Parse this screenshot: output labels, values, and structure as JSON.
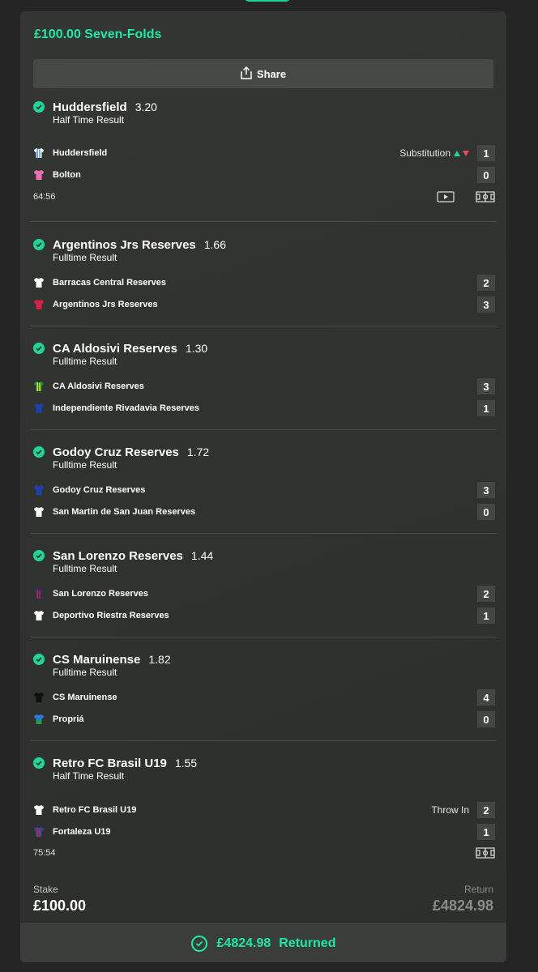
{
  "bet": {
    "title": "£100.00 Seven-Folds",
    "share_label": "Share"
  },
  "selections": [
    {
      "team": "Huddersfield",
      "odds": "3.20",
      "market": "Half Time Result",
      "home": {
        "name": "Huddersfield",
        "score": "1",
        "event": "Substitution"
      },
      "away": {
        "name": "Bolton",
        "score": "0"
      },
      "clock": "64:56"
    },
    {
      "team": "Argentinos Jrs Reserves",
      "odds": "1.66",
      "market": "Fulltime Result",
      "home": {
        "name": "Barracas Central Reserves",
        "score": "2"
      },
      "away": {
        "name": "Argentinos Jrs Reserves",
        "score": "3"
      }
    },
    {
      "team": "CA Aldosivi Reserves",
      "odds": "1.30",
      "market": "Fulltime Result",
      "home": {
        "name": "CA Aldosivi Reserves",
        "score": "3"
      },
      "away": {
        "name": "Independiente Rivadavia Reserves",
        "score": "1"
      }
    },
    {
      "team": "Godoy Cruz Reserves",
      "odds": "1.72",
      "market": "Fulltime Result",
      "home": {
        "name": "Godoy Cruz Reserves",
        "score": "3"
      },
      "away": {
        "name": "San Martin de San Juan Reserves",
        "score": "0"
      }
    },
    {
      "team": "San Lorenzo Reserves",
      "odds": "1.44",
      "market": "Fulltime Result",
      "home": {
        "name": "San Lorenzo Reserves",
        "score": "2"
      },
      "away": {
        "name": "Deportivo Riestra Reserves",
        "score": "1"
      }
    },
    {
      "team": "CS Maruinense",
      "odds": "1.82",
      "market": "Fulltime Result",
      "home": {
        "name": "CS Maruinense",
        "score": "4"
      },
      "away": {
        "name": "Propriá",
        "score": "0"
      }
    },
    {
      "team": "Retro FC Brasil U19",
      "odds": "1.55",
      "market": "Half Time Result",
      "home": {
        "name": "Retro FC Brasil U19",
        "score": "2",
        "event": "Throw In"
      },
      "away": {
        "name": "Fortaleza U19",
        "score": "1"
      },
      "clock": "75:54"
    }
  ],
  "footer": {
    "stake_label": "Stake",
    "stake_value": "£100.00",
    "return_label": "Return",
    "return_value": "£4824.98",
    "returned_amount": "£4824.98",
    "returned_label": "Returned"
  },
  "colors": {
    "accent": "#1ee8a5",
    "card_bg": "#323432",
    "page_bg": "#242524",
    "score_bg": "#444644"
  }
}
